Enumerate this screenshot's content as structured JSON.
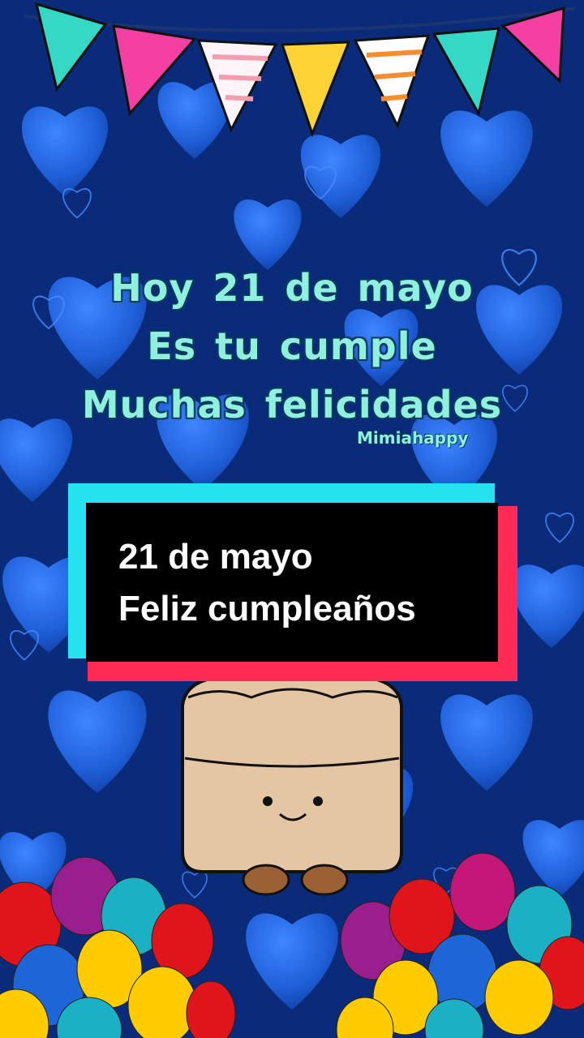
{
  "greeting": {
    "line1": "Hoy 21 de mayo",
    "line2": "Es tu cumple",
    "line3": "Muchas felicidades",
    "signature": "Mimiahappy"
  },
  "caption": {
    "line1": "21 de mayo",
    "line2": "Feliz cumpleaños"
  },
  "colors": {
    "background": "#0a2a7a",
    "heart": "#1f5fd8",
    "greeting_text": "#8ff0dd",
    "caption_cyan": "#25e2ef",
    "caption_red": "#fe2c55"
  },
  "decorations": {
    "bunting": "party-bunting",
    "character": "bread-character",
    "balloons": "balloon-bunches"
  }
}
